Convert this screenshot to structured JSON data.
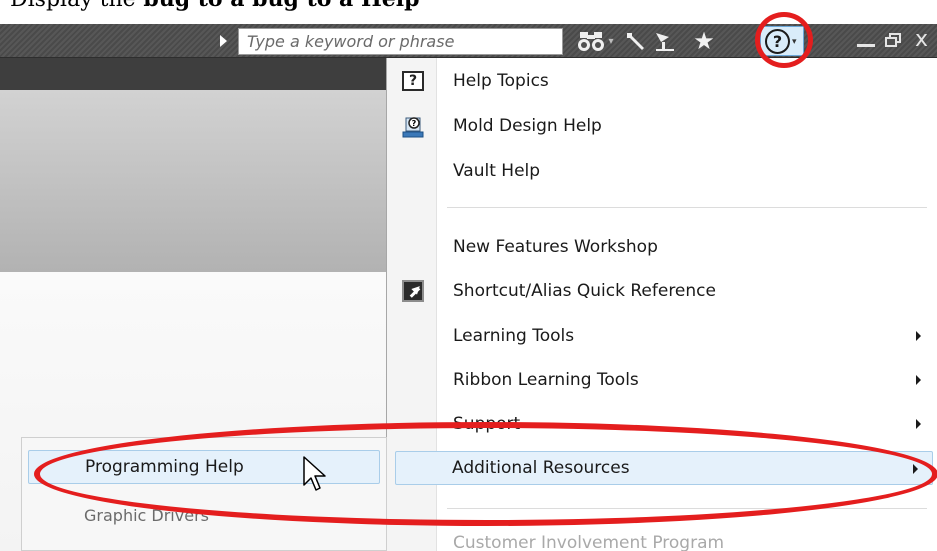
{
  "doc_caption": {
    "prefix": "Display the",
    "text": " bug to a bug to a Help"
  },
  "search": {
    "placeholder": "Type a keyword or phrase"
  },
  "toolbar": {
    "icons": [
      "binoculars-icon",
      "wrench-icon",
      "satellite-icon",
      "star-icon",
      "help-icon"
    ],
    "help_glyph": "?"
  },
  "window_controls": {
    "close_glyph": "x"
  },
  "menu": {
    "items": [
      {
        "label": "Help Topics",
        "icon": "help-topics-icon"
      },
      {
        "label": "Mold Design Help",
        "icon": "mold-design-icon"
      },
      {
        "label": "Vault Help"
      },
      {
        "label": "New Features Workshop"
      },
      {
        "label": "Shortcut/Alias Quick Reference",
        "icon": "shortcut-icon"
      },
      {
        "label": "Learning Tools",
        "submenu": true
      },
      {
        "label": "Ribbon Learning Tools",
        "submenu": true
      },
      {
        "label": "Support",
        "submenu": true
      },
      {
        "label": "Additional Resources",
        "submenu": true,
        "highlighted": true
      },
      {
        "label": "Customer Involvement Program",
        "disabled": true
      }
    ]
  },
  "submenu": {
    "items": [
      {
        "label": "Programming Help",
        "highlighted": true
      },
      {
        "label": "Graphic Drivers"
      }
    ]
  },
  "colors": {
    "annotation": "#e41e1e",
    "highlight": "#e5f1fb",
    "titlebar": "#505050"
  }
}
